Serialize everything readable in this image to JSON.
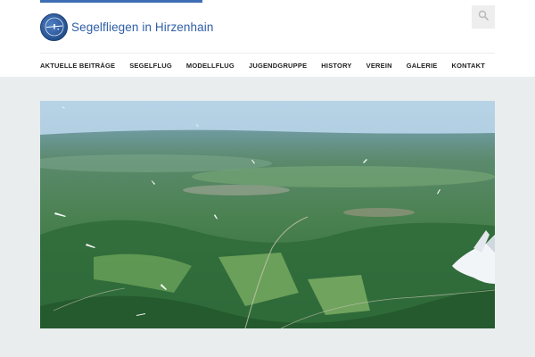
{
  "site": {
    "title": "Segelfliegen in Hirzenhain",
    "logo_icon": "glider-emblem-icon",
    "accent_color": "#3d6db4"
  },
  "search": {
    "icon": "search-icon"
  },
  "nav": {
    "items": [
      "AKTUELLE BEITRÄGE",
      "SEGELFLUG",
      "MODELLFLUG",
      "JUGENDGRUPPE",
      "HISTORY",
      "VEREIN",
      "GALERIE",
      "KONTAKT"
    ]
  },
  "hero": {
    "subject": "aerial landscape with gliders",
    "sky_color": "#a9c9e0",
    "forest_color": "#2e6b3b"
  }
}
